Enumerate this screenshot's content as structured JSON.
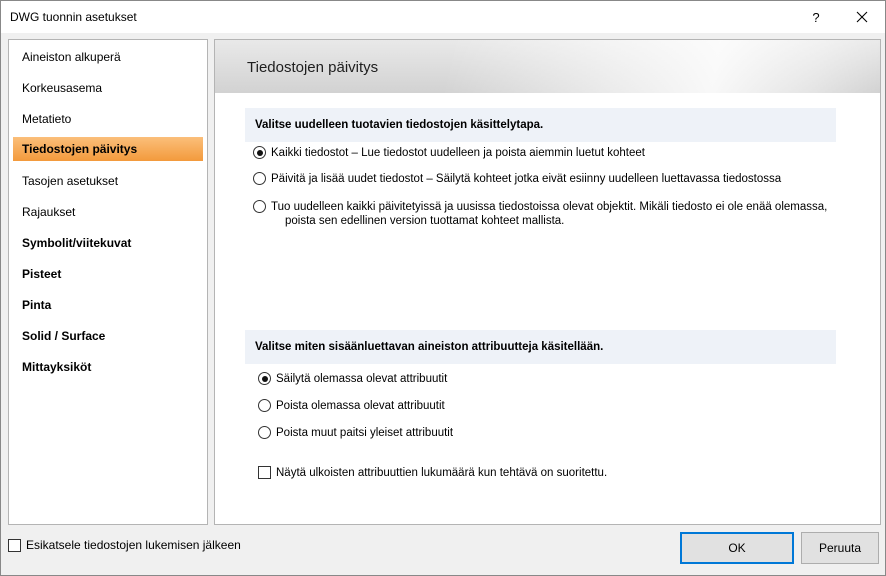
{
  "window": {
    "title": "DWG tuonnin asetukset",
    "help_label": "?"
  },
  "nav": {
    "items": [
      {
        "label": "Aineiston alkuperä"
      },
      {
        "label": "Korkeusasema"
      },
      {
        "label": "Metatieto"
      },
      {
        "label": "Tiedostojen päivitys"
      },
      {
        "label": "Tasojen asetukset"
      },
      {
        "label": "Rajaukset"
      },
      {
        "label": "Symbolit/viitekuvat"
      },
      {
        "label": "Pisteet"
      },
      {
        "label": "Pinta"
      },
      {
        "label": "Solid / Surface"
      },
      {
        "label": "Mittayksiköt"
      }
    ],
    "selected_index": 3
  },
  "panel": {
    "title": "Tiedostojen päivitys",
    "section1": {
      "header": "Valitse uudelleen tuotavien tiedostojen käsittelytapa.",
      "options": [
        {
          "label": "Kaikki tiedostot – Lue tiedostot uudelleen ja poista aiemmin luetut kohteet",
          "checked": true
        },
        {
          "label": "Päivitä ja lisää uudet tiedostot – Säilytä kohteet jotka eivät esiinny uudelleen luettavassa tiedostossa",
          "checked": false
        },
        {
          "label": "Tuo uudelleen kaikki päivitetyissä ja uusissa tiedostoissa olevat objektit. Mikäli tiedosto ei ole enää olemassa,",
          "label2": "poista sen edellinen version tuottamat kohteet mallista.",
          "checked": false
        }
      ]
    },
    "section2": {
      "header": "Valitse miten sisäänluettavan aineiston attribuutteja käsitellään.",
      "options": [
        {
          "label": "Säilytä olemassa olevat attribuutit",
          "checked": true
        },
        {
          "label": "Poista olemassa olevat attribuutit",
          "checked": false
        },
        {
          "label": "Poista muut paitsi yleiset attribuutit",
          "checked": false
        }
      ],
      "checkbox_label": "Näytä ulkoisten attribuuttien lukumäärä kun tehtävä on suoritettu."
    }
  },
  "footer": {
    "preview_checkbox_label": "Esikatsele tiedostojen lukemisen jälkeen",
    "ok_label": "OK",
    "cancel_label": "Peruuta"
  },
  "colors": {
    "selected_nav": "#f39a3c",
    "section_header_bg": "#eef2f8",
    "ok_border": "#0078d7"
  },
  "icons": {
    "close": "close-icon",
    "help": "help-icon"
  }
}
